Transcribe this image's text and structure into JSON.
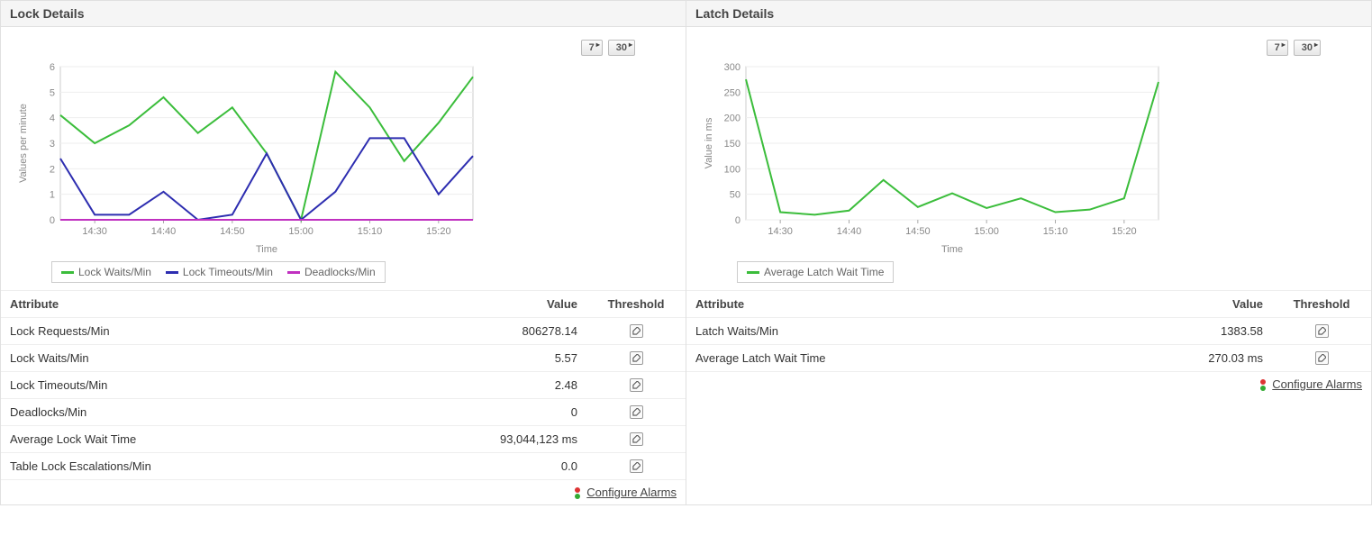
{
  "panels": {
    "lock": {
      "title": "Lock Details"
    },
    "latch": {
      "title": "Latch Details"
    }
  },
  "range": {
    "seven": "7",
    "thirty": "30"
  },
  "headers": {
    "attribute": "Attribute",
    "value": "Value",
    "threshold": "Threshold"
  },
  "lock_table": [
    {
      "attr": "Lock Requests/Min",
      "value": "806278.14"
    },
    {
      "attr": "Lock Waits/Min",
      "value": "5.57"
    },
    {
      "attr": "Lock Timeouts/Min",
      "value": "2.48"
    },
    {
      "attr": "Deadlocks/Min",
      "value": "0"
    },
    {
      "attr": "Average Lock Wait Time",
      "value": "93,044,123 ms"
    },
    {
      "attr": "Table Lock Escalations/Min",
      "value": "0.0"
    }
  ],
  "latch_table": [
    {
      "attr": "Latch Waits/Min",
      "value": "1383.58"
    },
    {
      "attr": "Average Latch Wait Time",
      "value": "270.03 ms"
    }
  ],
  "config_alarms": "Configure Alarms",
  "lock_legend": [
    {
      "name": "Lock Waits/Min",
      "color": "#3bbd3b"
    },
    {
      "name": "Lock Timeouts/Min",
      "color": "#2d2db0"
    },
    {
      "name": "Deadlocks/Min",
      "color": "#c030c0"
    }
  ],
  "latch_legend": [
    {
      "name": "Average Latch Wait Time",
      "color": "#3bbd3b"
    }
  ],
  "axis": {
    "time": "Time",
    "vpm": "Values per minute",
    "vms": "Value in ms"
  },
  "chart_data": [
    {
      "type": "line",
      "panel": "lock",
      "xlabel": "Time",
      "ylabel": "Values per minute",
      "ylim": [
        0,
        6
      ],
      "yticks": [
        0,
        1,
        2,
        3,
        4,
        5,
        6
      ],
      "categories": [
        "14:25",
        "14:30",
        "14:35",
        "14:40",
        "14:45",
        "14:50",
        "14:55",
        "15:00",
        "15:05",
        "15:10",
        "15:15",
        "15:20",
        "15:22"
      ],
      "xticks": [
        "14:30",
        "14:40",
        "14:50",
        "15:00",
        "15:10",
        "15:20"
      ],
      "series": [
        {
          "name": "Lock Waits/Min",
          "color": "#3bbd3b",
          "values": [
            4.1,
            3.0,
            3.7,
            4.8,
            3.4,
            4.4,
            2.6,
            0.0,
            5.8,
            4.4,
            2.3,
            3.8,
            5.6
          ]
        },
        {
          "name": "Lock Timeouts/Min",
          "color": "#2d2db0",
          "values": [
            2.4,
            0.2,
            0.2,
            1.1,
            0.0,
            0.2,
            2.6,
            0.0,
            1.1,
            3.2,
            3.2,
            1.0,
            2.5
          ]
        },
        {
          "name": "Deadlocks/Min",
          "color": "#c030c0",
          "values": [
            0,
            0,
            0,
            0,
            0,
            0,
            0,
            0,
            0,
            0,
            0,
            0,
            0
          ]
        }
      ]
    },
    {
      "type": "line",
      "panel": "latch",
      "xlabel": "Time",
      "ylabel": "Value in ms",
      "ylim": [
        0,
        300
      ],
      "yticks": [
        0,
        50,
        100,
        150,
        200,
        250,
        300
      ],
      "categories": [
        "14:25",
        "14:30",
        "14:35",
        "14:40",
        "14:45",
        "14:50",
        "14:55",
        "15:00",
        "15:05",
        "15:10",
        "15:15",
        "15:20",
        "15:22"
      ],
      "xticks": [
        "14:30",
        "14:40",
        "14:50",
        "15:00",
        "15:10",
        "15:20"
      ],
      "series": [
        {
          "name": "Average Latch Wait Time",
          "color": "#3bbd3b",
          "values": [
            275,
            15,
            10,
            18,
            78,
            25,
            52,
            23,
            42,
            15,
            20,
            42,
            270
          ]
        }
      ]
    }
  ]
}
